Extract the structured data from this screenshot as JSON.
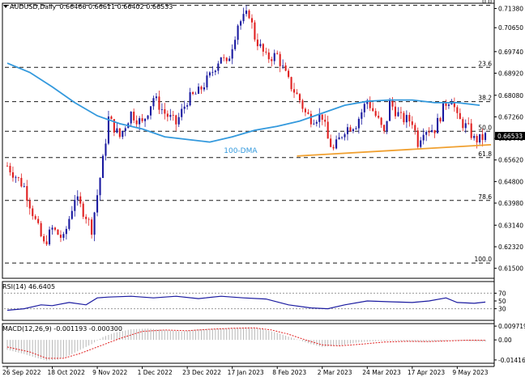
{
  "chart_data": {
    "type": "candlestick",
    "header": {
      "symbol": "AUDUSD,Daily",
      "ohlc": "0.66466 0.66611 0.66402 0.66533"
    },
    "price_axis": {
      "min": 0.6112,
      "max": 0.7158,
      "ticks": [
        "0.71380",
        "0.70650",
        "0.69740",
        "0.68920",
        "0.68080",
        "0.67260",
        "0.66440",
        "0.65620",
        "0.64800",
        "0.63980",
        "0.63140",
        "0.62320",
        "0.61500"
      ],
      "current_price_label": "0.66533"
    },
    "x_axis": {
      "labels": [
        "26 Sep 2022",
        "18 Oct 2022",
        "9 Nov 2022",
        "1 Dec 2022",
        "23 Dec 2022",
        "17 Jan 2023",
        "8 Feb 2023",
        "2 Mar 2023",
        "24 Mar 2023",
        "17 Apr 2023",
        "9 May 2023"
      ],
      "label_index": [
        0,
        16,
        32,
        48,
        64,
        80,
        96,
        112,
        128,
        144,
        160
      ]
    },
    "fib_levels": [
      {
        "label": "0.0",
        "price": 0.715
      },
      {
        "label": "23.6",
        "price": 0.6914
      },
      {
        "label": "38.2",
        "price": 0.6784
      },
      {
        "label": "50.0",
        "price": 0.6671
      },
      {
        "label": "61.8",
        "price": 0.6571
      },
      {
        "label": "78.6",
        "price": 0.6408
      },
      {
        "label": "100.0",
        "price": 0.617
      }
    ],
    "support_line": {
      "from": [
        103,
        0.6577
      ],
      "to": [
        172,
        0.662
      ]
    },
    "ma_label": "100-DMA",
    "ma_anchor": [
      77,
      0.662
    ],
    "ma_100": [
      [
        0,
        0.693
      ],
      [
        8,
        0.6895
      ],
      [
        16,
        0.684
      ],
      [
        24,
        0.678
      ],
      [
        32,
        0.673
      ],
      [
        40,
        0.67
      ],
      [
        48,
        0.668
      ],
      [
        56,
        0.665
      ],
      [
        64,
        0.664
      ],
      [
        72,
        0.663
      ],
      [
        80,
        0.665
      ],
      [
        88,
        0.6675
      ],
      [
        96,
        0.669
      ],
      [
        104,
        0.671
      ],
      [
        112,
        0.674
      ],
      [
        120,
        0.677
      ],
      [
        128,
        0.6785
      ],
      [
        136,
        0.679
      ],
      [
        144,
        0.679
      ],
      [
        152,
        0.678
      ],
      [
        160,
        0.678
      ],
      [
        168,
        0.677
      ]
    ],
    "price_path": [
      [
        0,
        0.654
      ],
      [
        6,
        0.646
      ],
      [
        10,
        0.633
      ],
      [
        13,
        0.624
      ],
      [
        16,
        0.63
      ],
      [
        20,
        0.626
      ],
      [
        24,
        0.642
      ],
      [
        28,
        0.635
      ],
      [
        30,
        0.63
      ],
      [
        34,
        0.656
      ],
      [
        36,
        0.672
      ],
      [
        40,
        0.665
      ],
      [
        44,
        0.674
      ],
      [
        48,
        0.67
      ],
      [
        52,
        0.68
      ],
      [
        56,
        0.674
      ],
      [
        60,
        0.67
      ],
      [
        64,
        0.679
      ],
      [
        68,
        0.682
      ],
      [
        72,
        0.688
      ],
      [
        76,
        0.696
      ],
      [
        78,
        0.692
      ],
      [
        82,
        0.708
      ],
      [
        86,
        0.712
      ],
      [
        88,
        0.703
      ],
      [
        92,
        0.695
      ],
      [
        96,
        0.696
      ],
      [
        100,
        0.686
      ],
      [
        104,
        0.679
      ],
      [
        106,
        0.674
      ],
      [
        108,
        0.672
      ],
      [
        112,
        0.673
      ],
      [
        114,
        0.664
      ],
      [
        116,
        0.66
      ],
      [
        120,
        0.668
      ],
      [
        124,
        0.67
      ],
      [
        128,
        0.679
      ],
      [
        132,
        0.671
      ],
      [
        134,
        0.666
      ],
      [
        136,
        0.678
      ],
      [
        140,
        0.672
      ],
      [
        144,
        0.671
      ],
      [
        146,
        0.663
      ],
      [
        148,
        0.668
      ],
      [
        152,
        0.668
      ],
      [
        156,
        0.678
      ],
      [
        158,
        0.68
      ],
      [
        160,
        0.672
      ],
      [
        164,
        0.668
      ],
      [
        166,
        0.664
      ],
      [
        168,
        0.664
      ],
      [
        170,
        0.6653
      ]
    ],
    "rsi": {
      "label": "RSI(14) 46.6405",
      "ticks": [
        "70",
        "50",
        "30"
      ],
      "range": [
        0,
        100
      ],
      "path": [
        [
          0,
          26
        ],
        [
          6,
          30
        ],
        [
          12,
          40
        ],
        [
          16,
          38
        ],
        [
          22,
          46
        ],
        [
          28,
          40
        ],
        [
          32,
          58
        ],
        [
          36,
          60
        ],
        [
          44,
          62
        ],
        [
          52,
          58
        ],
        [
          60,
          62
        ],
        [
          68,
          56
        ],
        [
          76,
          62
        ],
        [
          84,
          58
        ],
        [
          92,
          55
        ],
        [
          100,
          40
        ],
        [
          108,
          32
        ],
        [
          114,
          30
        ],
        [
          120,
          40
        ],
        [
          128,
          50
        ],
        [
          136,
          48
        ],
        [
          144,
          46
        ],
        [
          150,
          50
        ],
        [
          156,
          58
        ],
        [
          160,
          46
        ],
        [
          166,
          44
        ],
        [
          170,
          47
        ]
      ]
    },
    "macd": {
      "label": "MACD(12,26,9) -0.001193 -0.000300",
      "ticks": [
        "0.009719",
        "0.00",
        "-0.014164"
      ],
      "range": [
        -0.0165,
        0.0115
      ],
      "histogram": [
        [
          0,
          -0.007
        ],
        [
          6,
          -0.01
        ],
        [
          10,
          -0.0125
        ],
        [
          14,
          -0.0145
        ],
        [
          18,
          -0.014
        ],
        [
          22,
          -0.011
        ],
        [
          26,
          -0.007
        ],
        [
          30,
          -0.003
        ],
        [
          34,
          0.002
        ],
        [
          38,
          0.005
        ],
        [
          44,
          0.0075
        ],
        [
          50,
          0.008
        ],
        [
          56,
          0.007
        ],
        [
          62,
          0.006
        ],
        [
          68,
          0.0075
        ],
        [
          74,
          0.008
        ],
        [
          80,
          0.0085
        ],
        [
          86,
          0.009
        ],
        [
          90,
          0.008
        ],
        [
          96,
          0.005
        ],
        [
          102,
          0.001
        ],
        [
          108,
          -0.003
        ],
        [
          112,
          -0.005
        ],
        [
          118,
          -0.004
        ],
        [
          124,
          -0.002
        ],
        [
          130,
          -0.001
        ],
        [
          136,
          -0.0005
        ],
        [
          142,
          -0.0012
        ],
        [
          148,
          -0.0015
        ],
        [
          154,
          -0.001
        ],
        [
          158,
          -0.0002
        ],
        [
          164,
          -0.0008
        ],
        [
          170,
          -0.0012
        ]
      ],
      "signal": [
        [
          0,
          -0.005
        ],
        [
          8,
          -0.0085
        ],
        [
          14,
          -0.013
        ],
        [
          20,
          -0.013
        ],
        [
          26,
          -0.0095
        ],
        [
          32,
          -0.005
        ],
        [
          40,
          0.001
        ],
        [
          48,
          0.006
        ],
        [
          56,
          0.007
        ],
        [
          64,
          0.0065
        ],
        [
          72,
          0.0075
        ],
        [
          80,
          0.0082
        ],
        [
          88,
          0.0085
        ],
        [
          94,
          0.007
        ],
        [
          100,
          0.004
        ],
        [
          106,
          0.0
        ],
        [
          112,
          -0.0035
        ],
        [
          118,
          -0.0042
        ],
        [
          126,
          -0.003
        ],
        [
          134,
          -0.0015
        ],
        [
          142,
          -0.001
        ],
        [
          150,
          -0.0012
        ],
        [
          158,
          -0.0006
        ],
        [
          164,
          -0.0002
        ],
        [
          170,
          -0.0003
        ]
      ]
    },
    "colors": {
      "bull": "#1a1aa0",
      "bear": "#e02020",
      "ma": "#3399dd",
      "fib": "#1a1a1a",
      "support": "#f0a030",
      "rsi": "#1a1aa0",
      "macd_hist": "#b8b8b8",
      "macd_signal": "#e02020"
    }
  }
}
